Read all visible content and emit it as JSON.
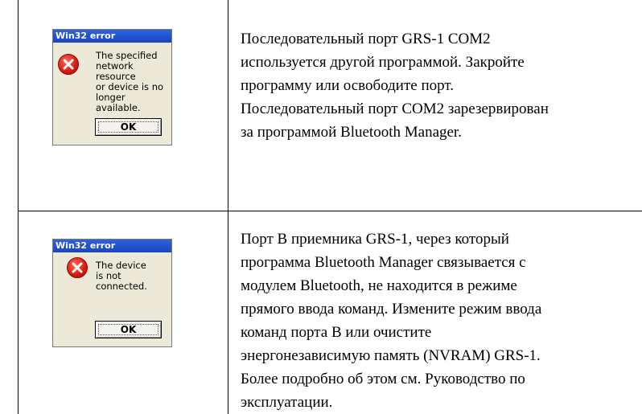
{
  "rows": [
    {
      "dialog": {
        "title": "Win32 error",
        "message_lines": [
          "The specified",
          "network resource",
          "or device is no",
          "longer available."
        ],
        "ok_label": "OK",
        "icon": "error-x-icon"
      },
      "description_lines": [
        "Последовательный порт GRS-1 COM2",
        "используется другой программой. Закройте",
        "программу или освободите порт.",
        "Последовательный порт COM2 зарезервирован",
        "за программой Bluetooth Manager."
      ]
    },
    {
      "dialog": {
        "title": "Win32 error",
        "message_lines": [
          "The device",
          "is not",
          "connected."
        ],
        "ok_label": "OK",
        "icon": "error-x-icon"
      },
      "description_lines": [
        "Порт B приемника GRS-1, через который",
        "программа Bluetooth Manager связывается с",
        "модулем Bluetooth, не находится в режиме",
        "прямого ввода команд. Измените режим ввода",
        "команд порта B или очистите",
        "энергонезависимую память (NVRAM) GRS-1.",
        "Более подробно об этом см. Руководство по",
        "эксплуатации."
      ]
    }
  ],
  "colors": {
    "title_bar": "#1a45c2",
    "dialog_bg": "#ece9d8",
    "error_icon": "#d61a0c"
  }
}
